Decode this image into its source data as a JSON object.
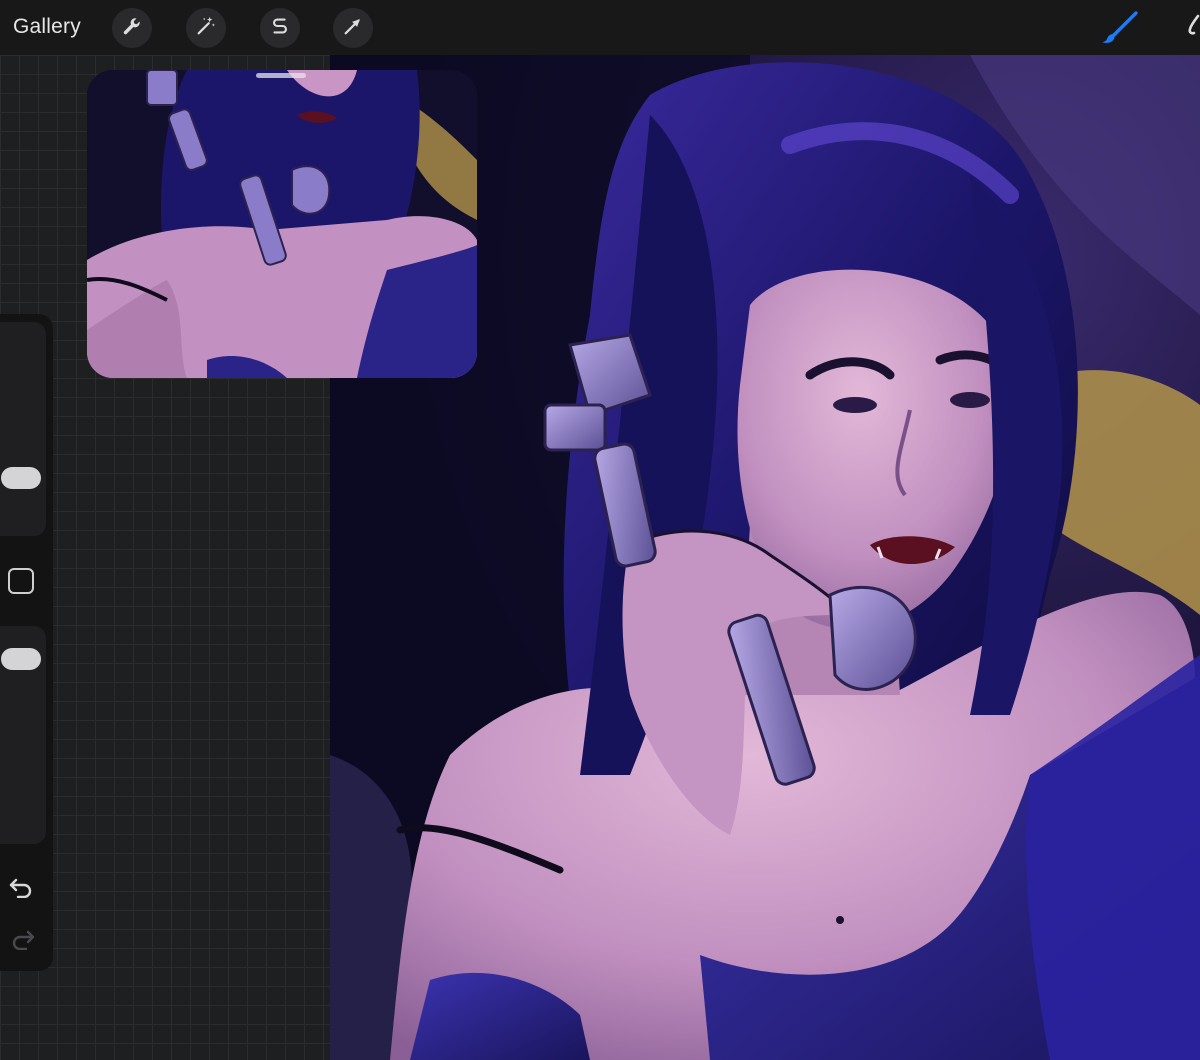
{
  "toolbar": {
    "gallery_label": "Gallery",
    "tools": [
      {
        "name": "actions",
        "icon": "wrench-icon"
      },
      {
        "name": "adjustments",
        "icon": "magic-wand-icon"
      },
      {
        "name": "selection",
        "icon": "selection-s-icon"
      },
      {
        "name": "transform",
        "icon": "arrow-cursor-icon"
      }
    ],
    "right_tools": [
      {
        "name": "brush",
        "icon": "brush-icon",
        "active": true,
        "color": "#1e7bf0"
      }
    ]
  },
  "sidebar": {
    "brush_size_level": 0.22,
    "opacity_level": 0.92,
    "modify_button_icon": "square-icon",
    "undo_icon": "undo-icon",
    "redo_icon": "redo-icon",
    "redo_enabled": false
  },
  "reference_window": {
    "visible": true,
    "content": "artwork-thumbnail"
  },
  "colors": {
    "accent": "#1e7bf0",
    "toolbar_bg": "#181819",
    "canvas_dark": "#0e0a22",
    "hair": "#221a6e",
    "skin": "#c99ac6",
    "gown": "#2b2488",
    "backdrop_gold": "#c6a24a"
  }
}
